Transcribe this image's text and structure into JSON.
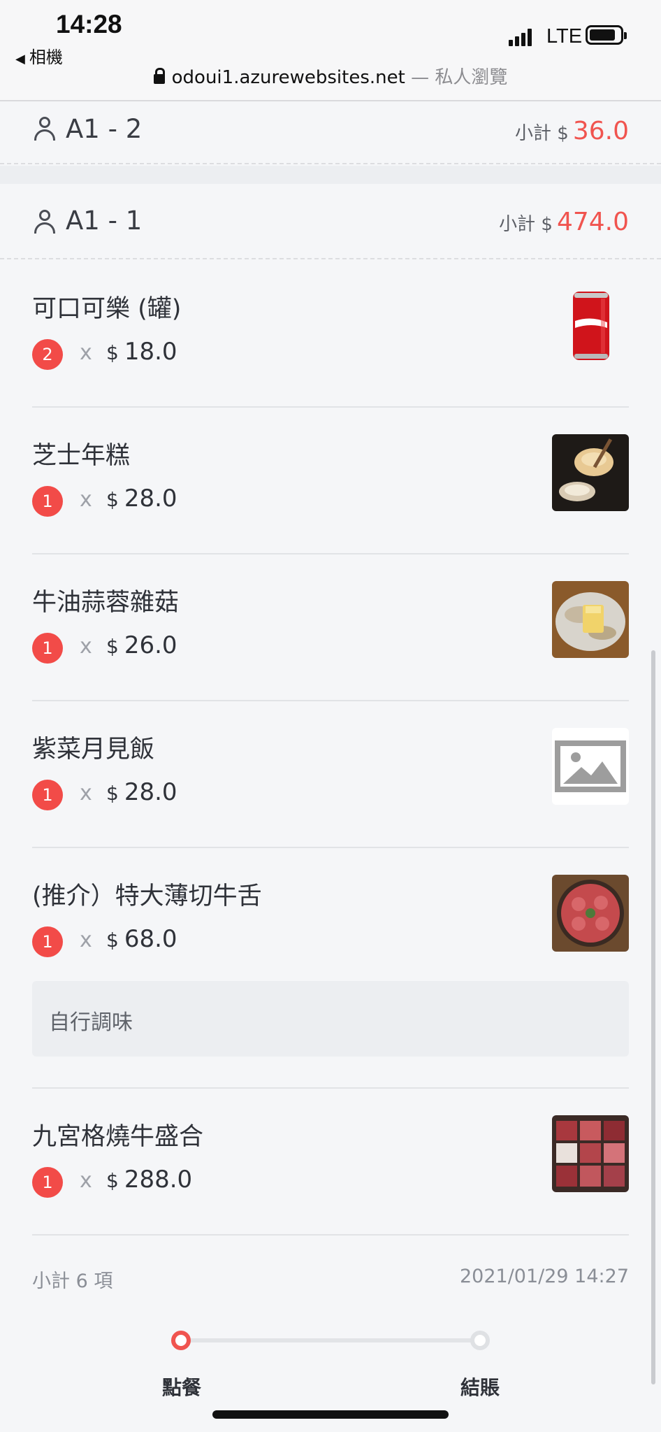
{
  "status_bar": {
    "time": "14:28",
    "back_app": "相機",
    "network": "LTE"
  },
  "browser": {
    "url": "odoui1.azurewebsites.net",
    "mode": "— 私人瀏覽"
  },
  "groups": [
    {
      "name": "A1 - 2",
      "subtotal_label": "小計 $",
      "subtotal": "36.0"
    },
    {
      "name": "A1 - 1",
      "subtotal_label": "小計 $",
      "subtotal": "474.0"
    }
  ],
  "currency": "$",
  "times": "x",
  "items": [
    {
      "name": "可口可樂 (罐)",
      "qty": "2",
      "price": "18.0",
      "image": "coca-cola-can"
    },
    {
      "name": "芝士年糕",
      "qty": "1",
      "price": "28.0",
      "image": "cheese-rice-cake"
    },
    {
      "name": "牛油蒜蓉雜菇",
      "qty": "1",
      "price": "26.0",
      "image": "butter-garlic-mushroom"
    },
    {
      "name": "紫菜月見飯",
      "qty": "1",
      "price": "28.0",
      "image": "image-placeholder"
    },
    {
      "name": "(推介）特大薄切牛舌",
      "qty": "1",
      "price": "68.0",
      "image": "sliced-beef-tongue",
      "note": "自行調味"
    },
    {
      "name": "九宮格燒牛盛合",
      "qty": "1",
      "price": "288.0",
      "image": "beef-platter"
    }
  ],
  "summary": {
    "count_label": "小計 6 項",
    "datetime": "2021/01/29 14:27"
  },
  "steps": [
    {
      "label": "點餐",
      "state": "active"
    },
    {
      "label": "結賬",
      "state": "inactive"
    }
  ],
  "colors": {
    "accent": "#f0544f",
    "badge": "#f24b48"
  }
}
